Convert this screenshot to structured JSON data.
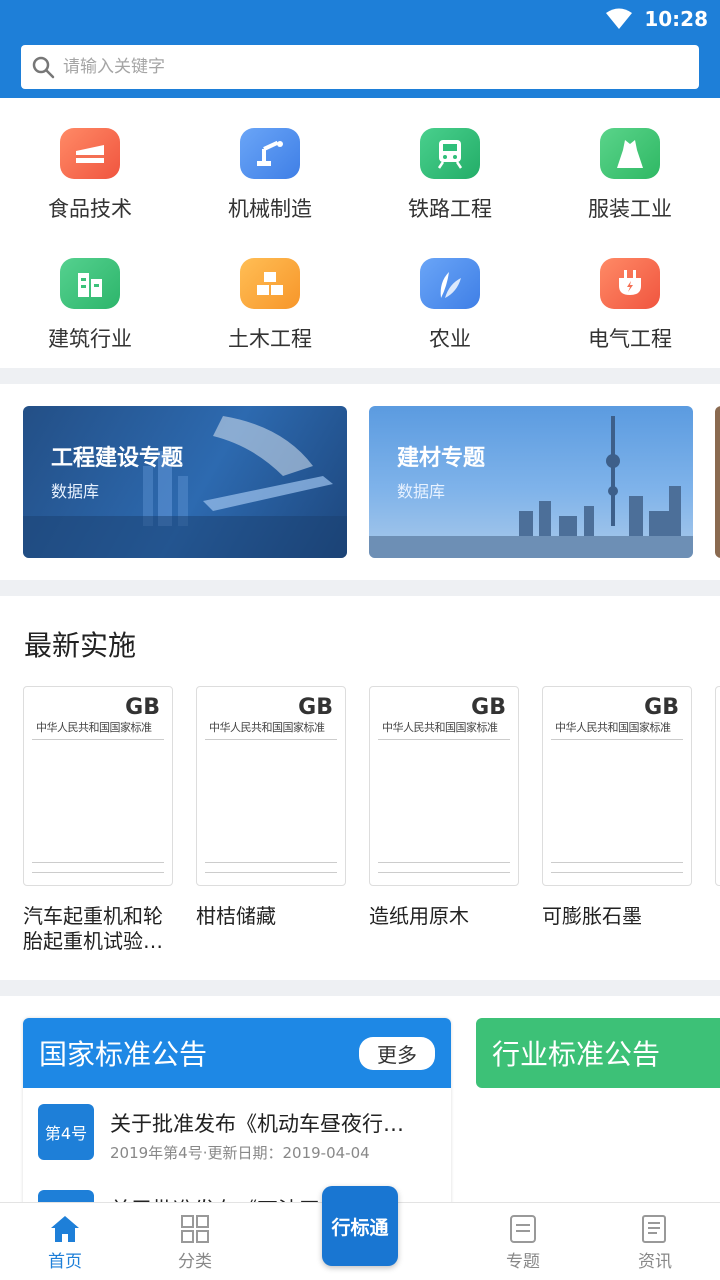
{
  "status": {
    "time": "10:28"
  },
  "search": {
    "placeholder": "请输入关键字"
  },
  "categories": [
    {
      "label": "食品技术",
      "icon": "cake-icon",
      "color": "#f46f53"
    },
    {
      "label": "机械制造",
      "icon": "robot-arm-icon",
      "color": "#4a8df2"
    },
    {
      "label": "铁路工程",
      "icon": "train-icon",
      "color": "#2fbf7a"
    },
    {
      "label": "服装工业",
      "icon": "dress-icon",
      "color": "#40c46e"
    },
    {
      "label": "建筑行业",
      "icon": "building-icon",
      "color": "#3cc27a"
    },
    {
      "label": "土木工程",
      "icon": "blocks-icon",
      "color": "#f7a43a"
    },
    {
      "label": "农业",
      "icon": "leaf-icon",
      "color": "#4a8df2"
    },
    {
      "label": "电气工程",
      "icon": "plug-icon",
      "color": "#f46f53"
    }
  ],
  "banners": [
    {
      "title": "工程建设专题",
      "subtitle": "数据库"
    },
    {
      "title": "建材专题",
      "subtitle": "数据库"
    }
  ],
  "latest": {
    "heading": "最新实施",
    "cover_mark": "GB",
    "cover_title": "中华人民共和国国家标准",
    "items": [
      {
        "name": "汽车起重机和轮胎起重机试验…"
      },
      {
        "name": "柑桔储藏"
      },
      {
        "name": "造纸用原木"
      },
      {
        "name": "可膨胀石墨"
      }
    ]
  },
  "notices": {
    "national": {
      "title": "国家标准公告",
      "more": "更多",
      "items": [
        {
          "badge": "第4号",
          "title": "关于批准发布《机动车昼夜行…",
          "meta": "2019年第4号·更新日期：2019-04-04"
        },
        {
          "badge": "",
          "title": "关于批准发布《石油天然气通…",
          "meta": ""
        }
      ]
    },
    "industry": {
      "title": "行业标准公告"
    }
  },
  "tabbar": {
    "home": "首页",
    "category": "分类",
    "center": "行标通",
    "topics": "专题",
    "news": "资讯"
  }
}
